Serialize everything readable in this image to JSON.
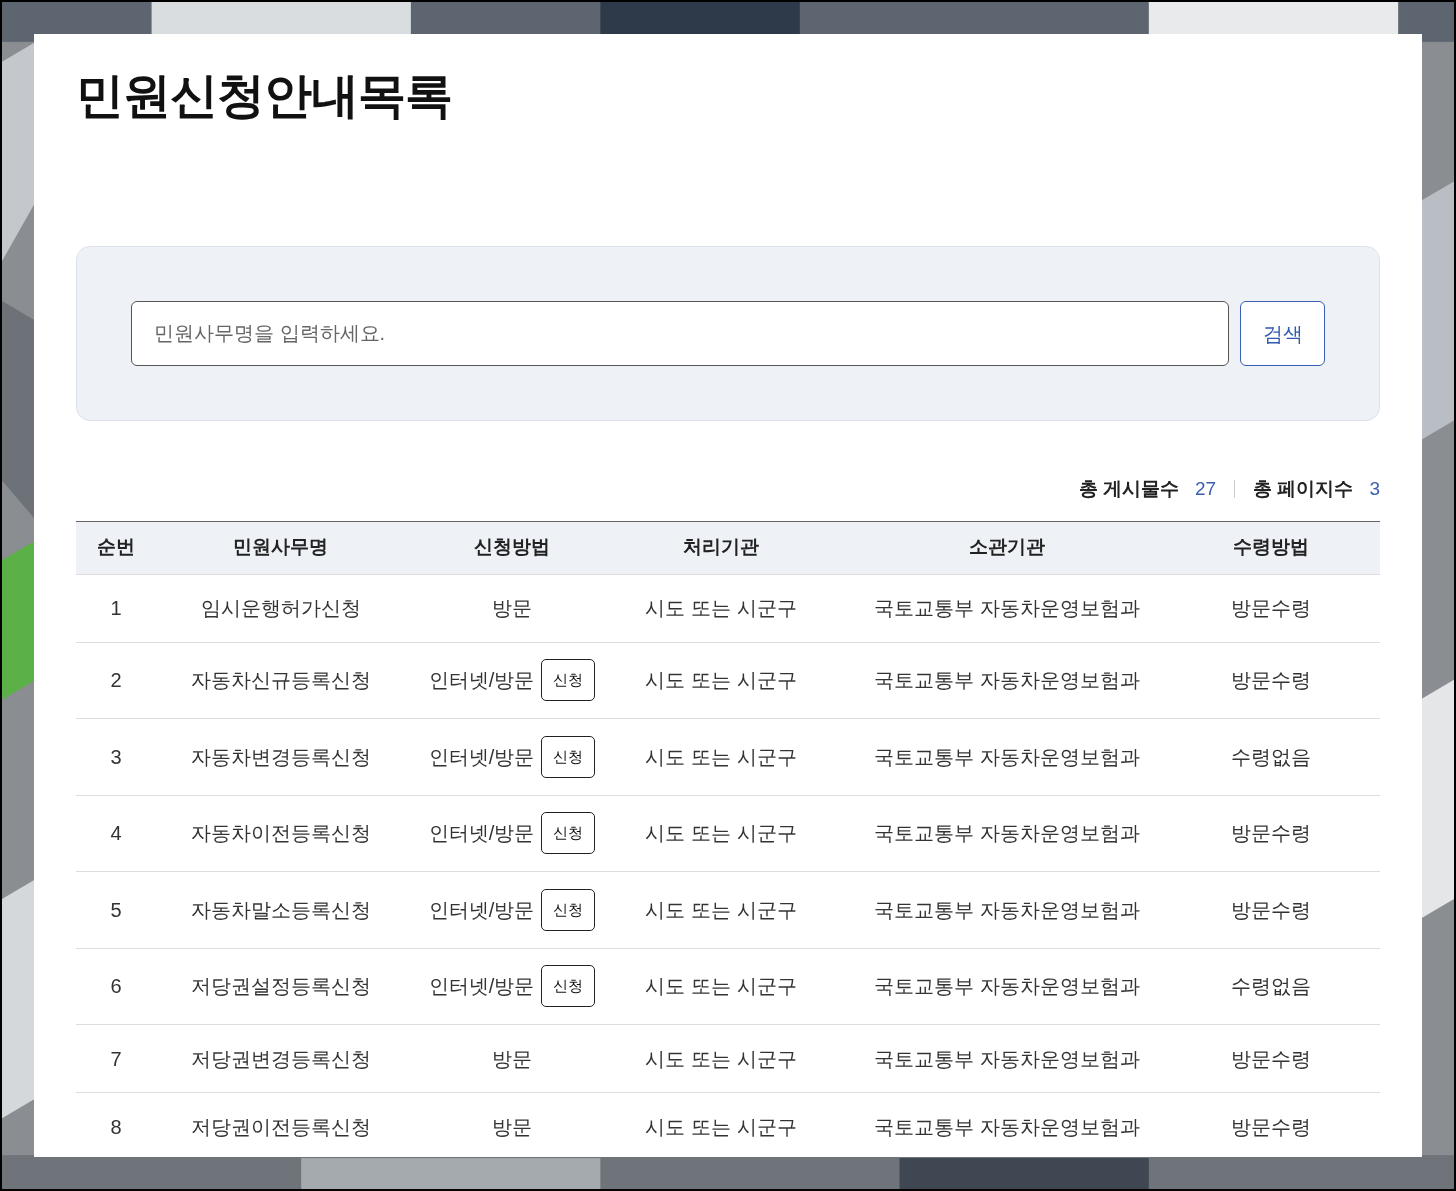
{
  "page": {
    "title": "민원신청안내목록"
  },
  "search": {
    "placeholder": "민원사무명을 입력하세요.",
    "button": "검색"
  },
  "summary": {
    "total_posts_label": "총 게시물수",
    "total_posts": "27",
    "total_pages_label": "총 페이지수",
    "total_pages": "3"
  },
  "table": {
    "columns": [
      "순번",
      "민원사무명",
      "신청방법",
      "처리기관",
      "소관기관",
      "수령방법"
    ],
    "rows": [
      {
        "no": "1",
        "name": "임시운행허가신청",
        "method": "방문",
        "agency": "시도 또는 시군구",
        "ministry": "국토교통부 자동차운영보험과",
        "receipt": "방문수령"
      },
      {
        "no": "2",
        "name": "자동차신규등록신청",
        "method": "인터넷/방문",
        "apply_button": "신청",
        "agency": "시도 또는 시군구",
        "ministry": "국토교통부 자동차운영보험과",
        "receipt": "방문수령"
      },
      {
        "no": "3",
        "name": "자동차변경등록신청",
        "method": "인터넷/방문",
        "apply_button": "신청",
        "agency": "시도 또는 시군구",
        "ministry": "국토교통부 자동차운영보험과",
        "receipt": "수령없음"
      },
      {
        "no": "4",
        "name": "자동차이전등록신청",
        "method": "인터넷/방문",
        "apply_button": "신청",
        "agency": "시도 또는 시군구",
        "ministry": "국토교통부 자동차운영보험과",
        "receipt": "방문수령"
      },
      {
        "no": "5",
        "name": "자동차말소등록신청",
        "method": "인터넷/방문",
        "apply_button": "신청",
        "agency": "시도 또는 시군구",
        "ministry": "국토교통부 자동차운영보험과",
        "receipt": "방문수령"
      },
      {
        "no": "6",
        "name": "저당권설정등록신청",
        "method": "인터넷/방문",
        "apply_button": "신청",
        "agency": "시도 또는 시군구",
        "ministry": "국토교통부 자동차운영보험과",
        "receipt": "수령없음"
      },
      {
        "no": "7",
        "name": "저당권변경등록신청",
        "method": "방문",
        "agency": "시도 또는 시군구",
        "ministry": "국토교통부 자동차운영보험과",
        "receipt": "방문수령"
      },
      {
        "no": "8",
        "name": "저당권이전등록신청",
        "method": "방문",
        "agency": "시도 또는 시군구",
        "ministry": "국토교통부 자동차운영보험과",
        "receipt": "방문수령"
      }
    ]
  }
}
